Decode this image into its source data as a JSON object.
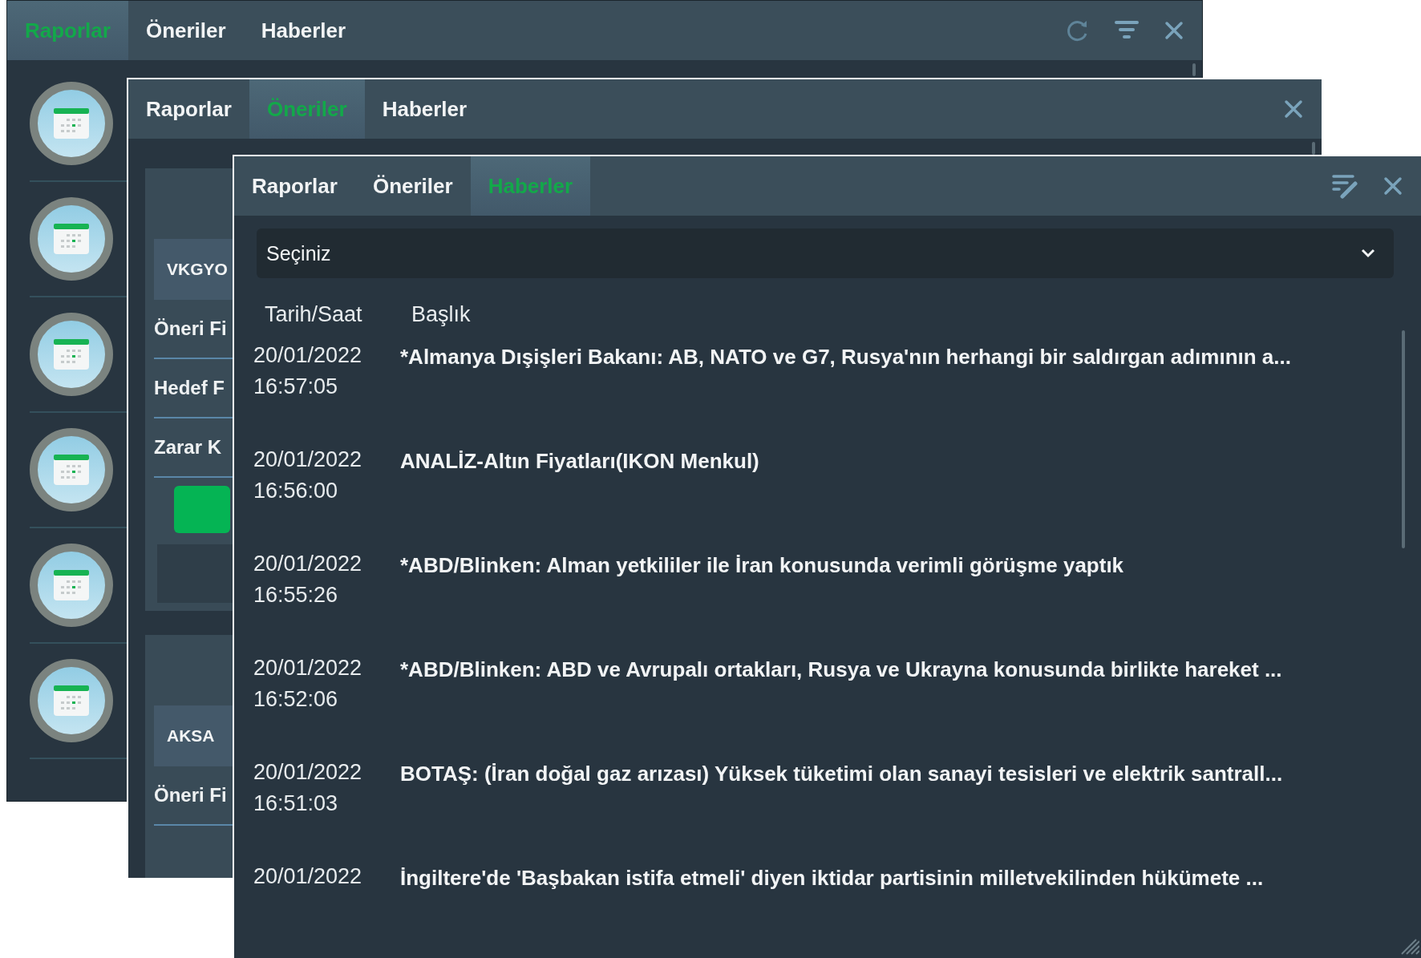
{
  "windows": [
    {
      "kind": "list",
      "tabs": [
        {
          "label": "Raporlar",
          "selected": true
        },
        {
          "label": "Öneriler",
          "selected": false
        },
        {
          "label": "Haberler",
          "selected": false
        }
      ]
    },
    {
      "kind": "cards",
      "tabs": [
        {
          "label": "Raporlar",
          "selected": false
        },
        {
          "label": "Öneriler",
          "selected": true
        },
        {
          "label": "Haberler",
          "selected": false
        }
      ],
      "cards": [
        {
          "symbol": "VKGYO",
          "fields": [
            "Öneri Fi",
            "Hedef F",
            "Zarar K"
          ],
          "has_button": true
        },
        {
          "symbol": "AKSA",
          "fields": [
            "Öneri Fi"
          ],
          "has_button": false
        }
      ]
    },
    {
      "kind": "news",
      "tabs": [
        {
          "label": "Raporlar",
          "selected": false
        },
        {
          "label": "Öneriler",
          "selected": false
        },
        {
          "label": "Haberler",
          "selected": true
        }
      ],
      "dropdown": {
        "value": "Seçiniz"
      },
      "columns": [
        "Tarih/Saat",
        "Başlık"
      ],
      "rows": [
        {
          "date": "20/01/2022",
          "time": "16:57:05",
          "title": "*Almanya Dışişleri Bakanı: AB, NATO ve G7, Rusya'nın herhangi bir saldırgan adımının a..."
        },
        {
          "date": "20/01/2022",
          "time": "16:56:00",
          "title": "ANALİZ-Altın Fiyatları(IKON Menkul)"
        },
        {
          "date": "20/01/2022",
          "time": "16:55:26",
          "title": "*ABD/Blinken: Alman yetkililer ile İran konusunda verimli görüşme yaptık"
        },
        {
          "date": "20/01/2022",
          "time": "16:52:06",
          "title": "*ABD/Blinken: ABD ve Avrupalı ortakları, Rusya ve Ukrayna konusunda birlikte hareket ..."
        },
        {
          "date": "20/01/2022",
          "time": "16:51:03",
          "title": "BOTAŞ: (İran doğal gaz arızası) Yüksek tüketimi olan sanayi tesisleri ve elektrik santrall..."
        },
        {
          "date": "20/01/2022",
          "title": "İngiltere'de 'Başbakan istifa etmeli' diyen iktidar partisinin milletvekilinden hükümete ..."
        }
      ]
    }
  ]
}
